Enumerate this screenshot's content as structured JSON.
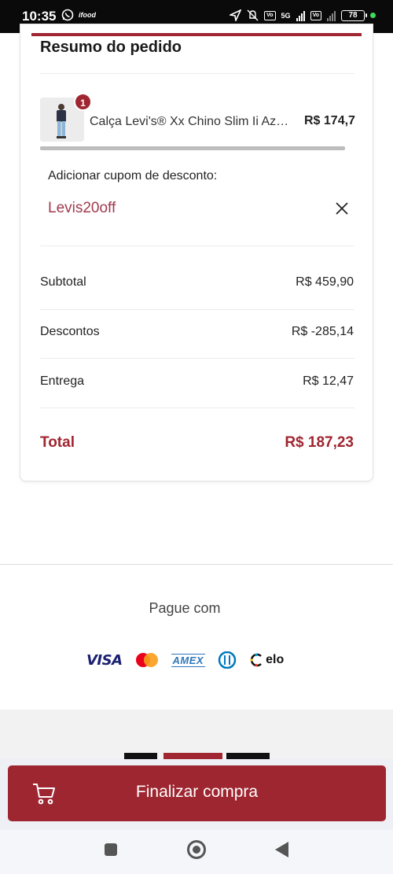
{
  "status_bar": {
    "time": "10:35",
    "icons": [
      "whatsapp-icon",
      "app-notification-icon",
      "location-icon",
      "mute-icon",
      "signal-icon",
      "battery-icon"
    ],
    "network_1": "5G",
    "battery": "78"
  },
  "order_summary": {
    "title": "Resumo do pedido",
    "item": {
      "quantity_badge": "1",
      "name": "Calça Levi's® Xx Chino Slim Ii Az…",
      "price": "R$ 174,7"
    },
    "coupon": {
      "label": "Adicionar cupom de desconto:",
      "value": "Levis20off"
    },
    "rows": [
      {
        "label": "Subtotal",
        "value": "R$ 459,90"
      },
      {
        "label": "Descontos",
        "value": "R$ -285,14"
      },
      {
        "label": "Entrega",
        "value": "R$ 12,47"
      }
    ],
    "total": {
      "label": "Total",
      "value": "R$ 187,23"
    }
  },
  "payment": {
    "title": "Pague com",
    "methods": [
      "VISA",
      "mastercard",
      "AMEX",
      "diners",
      "elo"
    ],
    "visa_label": "VISA",
    "amex_label": "AMEX",
    "elo_label": "elo"
  },
  "checkout": {
    "button_label": "Finalizar compra"
  },
  "colors": {
    "brand_red": "#9e2630",
    "coupon_text": "#a13a4e"
  }
}
